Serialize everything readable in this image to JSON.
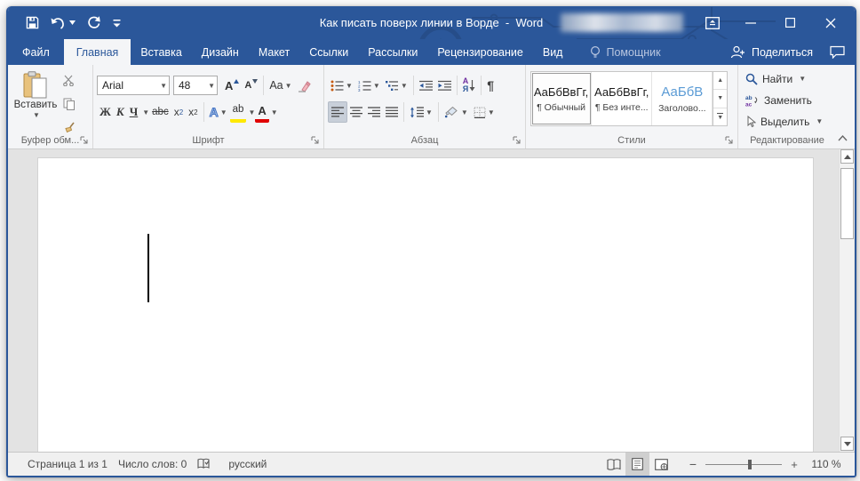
{
  "title_bar": {
    "title": "Как писать поверх линии в Ворде  -  Word"
  },
  "tabs": {
    "file": "Файл",
    "home": "Главная",
    "insert": "Вставка",
    "design": "Дизайн",
    "layout": "Макет",
    "references": "Ссылки",
    "mailings": "Рассылки",
    "review": "Рецензирование",
    "view": "Вид",
    "assistant": "Помощник",
    "share": "Поделиться"
  },
  "ribbon": {
    "clipboard": {
      "paste": "Вставить",
      "label": "Буфер обм..."
    },
    "font": {
      "label": "Шрифт",
      "family": "Arial",
      "size": "48",
      "bold": "Ж",
      "italic": "К",
      "underline": "Ч",
      "strikethrough": "abc",
      "sub_base": "x",
      "sub_n": "2",
      "sup_base": "x",
      "sup_n": "2",
      "case": "Aa",
      "grow": "A",
      "shrink": "A",
      "effects": "А",
      "highlight": "ab",
      "color": "А"
    },
    "paragraph": {
      "label": "Абзац",
      "sort_a": "А",
      "sort_z": "Я",
      "pilcrow": "¶"
    },
    "styles": {
      "label": "Стили",
      "items": [
        {
          "sample": "АаБбВвГг,",
          "name": "¶ Обычный"
        },
        {
          "sample": "АаБбВвГг,",
          "name": "¶ Без инте..."
        },
        {
          "sample": "АаБбВ",
          "name": "Заголово..."
        }
      ]
    },
    "editing": {
      "label": "Редактирование",
      "find": "Найти",
      "replace": "Заменить",
      "select": "Выделить"
    }
  },
  "statusbar": {
    "page": "Страница 1 из 1",
    "words": "Число слов: 0",
    "language": "русский",
    "zoom": "110 %"
  }
}
